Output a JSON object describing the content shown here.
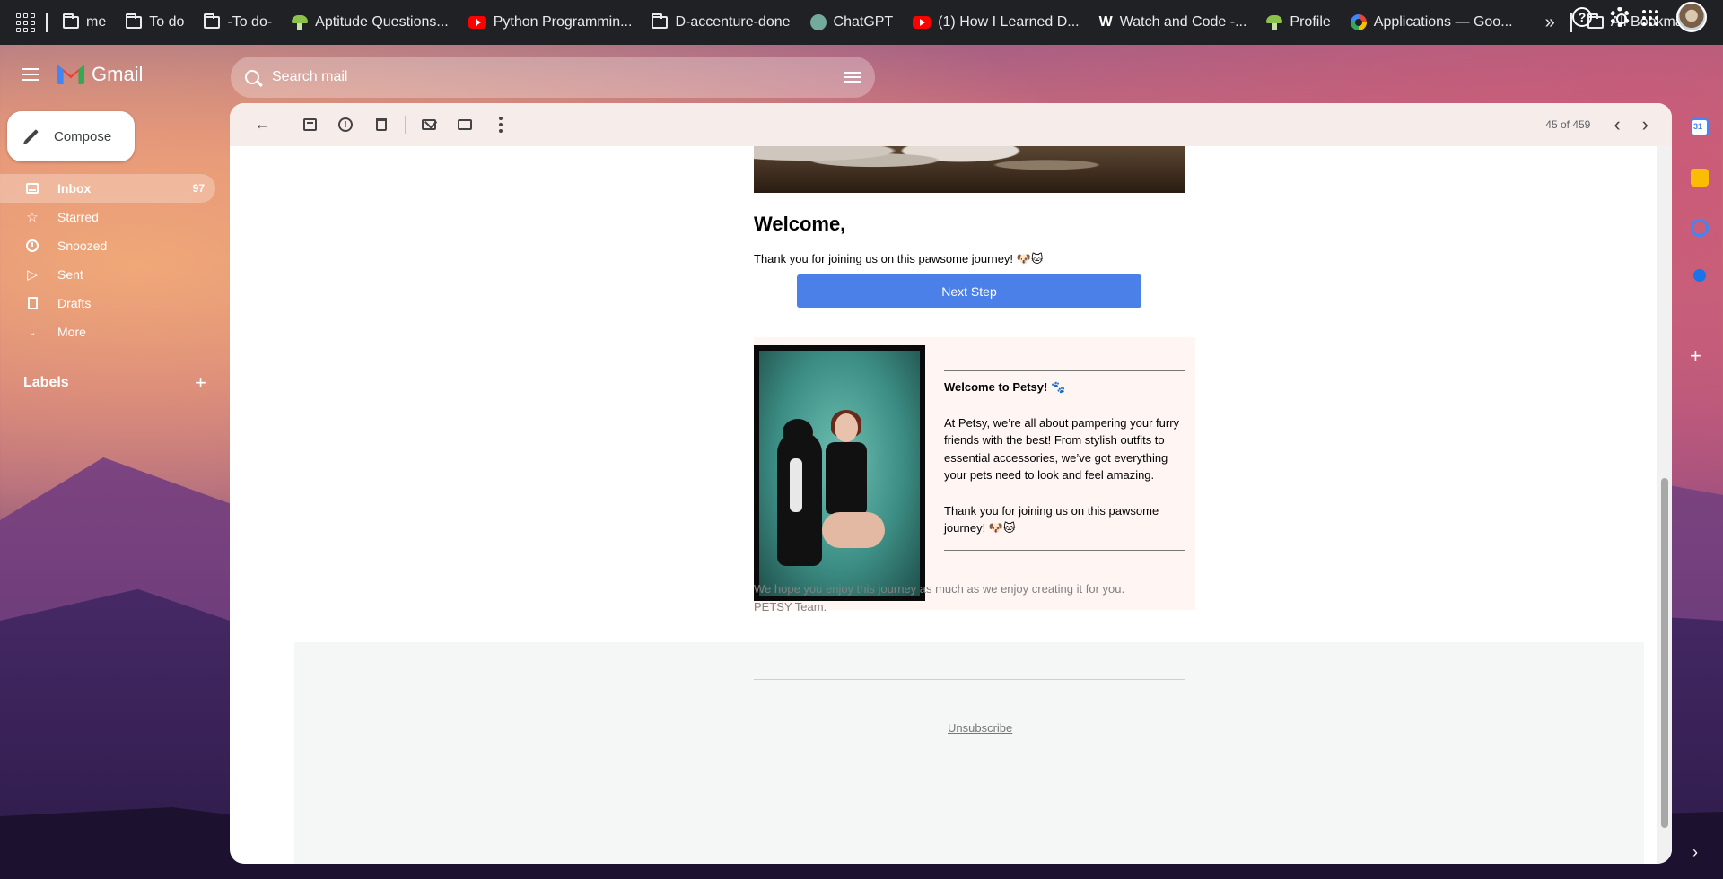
{
  "bookmarks": {
    "items": [
      {
        "label": "me",
        "icon": "folder-icon"
      },
      {
        "label": "To do",
        "icon": "folder-icon"
      },
      {
        "label": "-To do-",
        "icon": "folder-icon"
      },
      {
        "label": "Aptitude Questions...",
        "icon": "mushroom-icon"
      },
      {
        "label": "Python Programmin...",
        "icon": "youtube-icon"
      },
      {
        "label": "D-accenture-done",
        "icon": "folder-icon"
      },
      {
        "label": "ChatGPT",
        "icon": "chatgpt-icon"
      },
      {
        "label": "(1) How I Learned D...",
        "icon": "youtube-icon"
      },
      {
        "label": "Watch and Code -...",
        "icon": "w-icon"
      },
      {
        "label": "Profile",
        "icon": "mushroom-icon"
      },
      {
        "label": "Applications — Goo...",
        "icon": "google-icon"
      }
    ],
    "overflow": "»",
    "all_bookmarks": "All Bookmarks"
  },
  "header": {
    "app_name": "Gmail",
    "search_placeholder": "Search mail"
  },
  "sidebar": {
    "compose_label": "Compose",
    "items": [
      {
        "label": "Inbox",
        "count": "97",
        "icon": "inbox-icon",
        "active": true
      },
      {
        "label": "Starred",
        "icon": "star-icon"
      },
      {
        "label": "Snoozed",
        "icon": "clock-icon"
      },
      {
        "label": "Sent",
        "icon": "send-icon"
      },
      {
        "label": "Drafts",
        "icon": "draft-icon"
      },
      {
        "label": "More",
        "icon": "chevron-down-icon"
      }
    ],
    "labels_title": "Labels"
  },
  "toolbar": {
    "page_count": "45 of 459"
  },
  "email": {
    "welcome": "Welcome,",
    "thanks": "Thank you for joining us on this pawsome journey! 🐶🐱",
    "next_step": "Next Step",
    "card_title": "Welcome to Petsy! 🐾",
    "card_body": "At Petsy, we’re all about pampering your furry friends with the best! From stylish outfits to essential accessories, we’ve got everything your pets need to look and feel amazing.",
    "card_thanks": "Thank you for joining us on this pawsome journey! 🐶🐱",
    "footer_line1": "We hope you enjoy this journey as much as we enjoy creating it for you.",
    "footer_line2": "PETSY Team.",
    "unsubscribe": "Unsubscribe"
  },
  "colors": {
    "accent_button": "#4a80e8",
    "card_bg": "#fff6f4",
    "toolbar_bg": "#f6ecea"
  }
}
